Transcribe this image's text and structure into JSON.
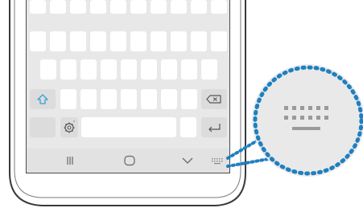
{
  "icons": {
    "shift": "shift-icon",
    "backspace": "backspace-icon",
    "settings": "settings-gear-icon",
    "enter": "enter-icon",
    "nav_recent": "recent-apps-icon",
    "nav_home": "home-icon",
    "nav_back": "chevron-down-icon",
    "keyboard_switch": "keyboard-switch-icon"
  },
  "colors": {
    "keyboard_bg": "#e8e8e8",
    "key": "#ffffff",
    "special_key": "#dcdcdc",
    "shift_accent": "#3aa0d8",
    "callout_dots": "#1f7fc0",
    "magnifier_bg": "#e9e9e9"
  }
}
